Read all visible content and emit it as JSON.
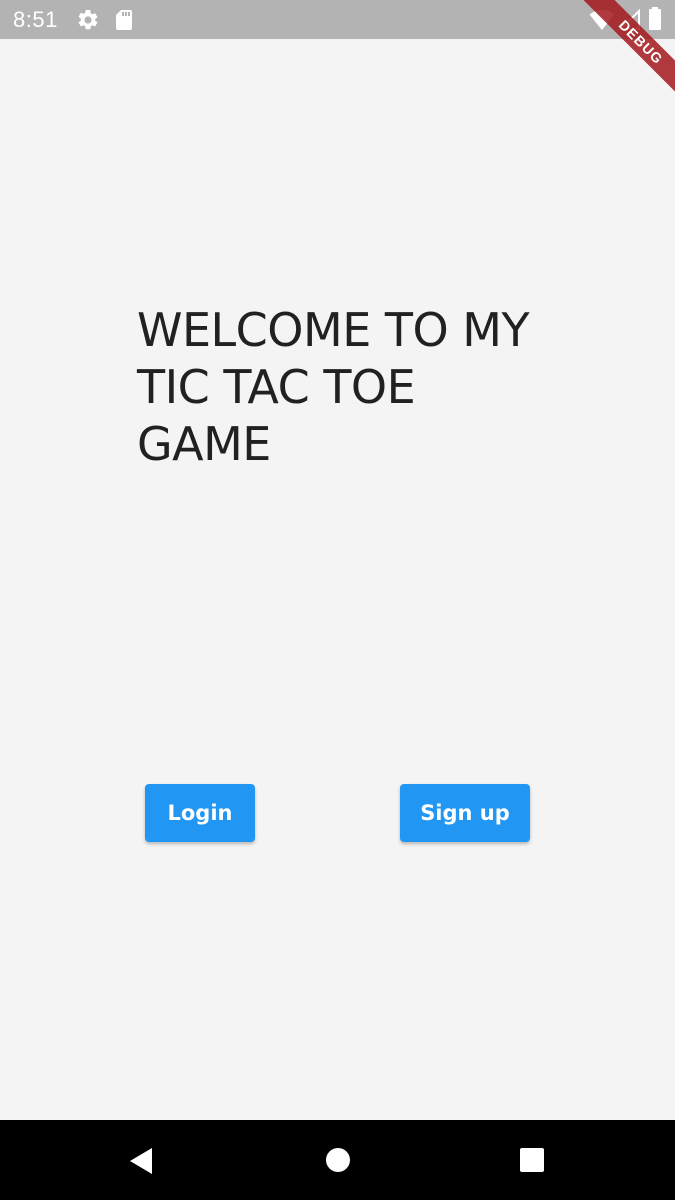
{
  "status_bar": {
    "time": "8:51",
    "icons": [
      "gear-icon",
      "sdcard-icon",
      "wifi-icon",
      "signal-icon",
      "battery-icon"
    ],
    "debug_banner": "DEBUG"
  },
  "main": {
    "title_lines": [
      "WELCOME TO MY",
      "TIC TAC TOE",
      "GAME"
    ],
    "login_label": "Login",
    "signup_label": "Sign up"
  },
  "nav_bar": {
    "icons": [
      "back-icon",
      "home-icon",
      "recent-apps-icon"
    ]
  },
  "colors": {
    "status_bar": "#b3b3b3",
    "background": "#f4f4f4",
    "accent": "#2196f3",
    "debug_banner": "#a3171c",
    "nav_bar": "#000000",
    "title_text": "#212121"
  }
}
